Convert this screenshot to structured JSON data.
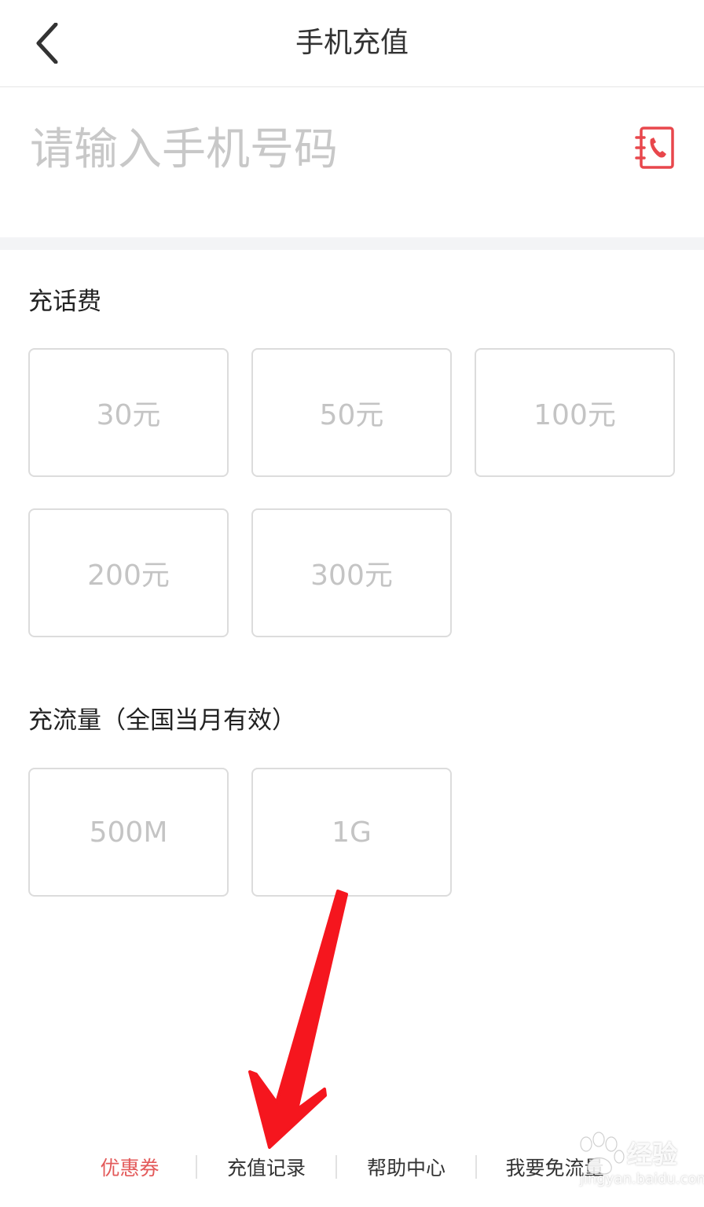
{
  "header": {
    "title": "手机充值",
    "back_icon": "chevron-left-icon"
  },
  "phone": {
    "placeholder": "请输入手机号码",
    "value": "",
    "contact_icon": "address-book-phone-icon",
    "accent": "#e8474c"
  },
  "recharge": {
    "title": "充话费",
    "options": [
      "30元",
      "50元",
      "100元",
      "200元",
      "300元"
    ]
  },
  "data_plan": {
    "title": "充流量（全国当月有效）",
    "options": [
      "500M",
      "1G"
    ]
  },
  "bottom_nav": {
    "items": [
      {
        "label": "优惠券",
        "color": "#e35a5a"
      },
      {
        "label": "充值记录",
        "color": "#333333"
      },
      {
        "label": "帮助中心",
        "color": "#333333"
      },
      {
        "label": "我要免流量",
        "color": "#333333"
      }
    ]
  },
  "annotation": {
    "arrow_color": "#f5161e"
  },
  "watermark": {
    "brand": "Bai",
    "text": "经验",
    "url": "jingyan.baidu.com"
  }
}
